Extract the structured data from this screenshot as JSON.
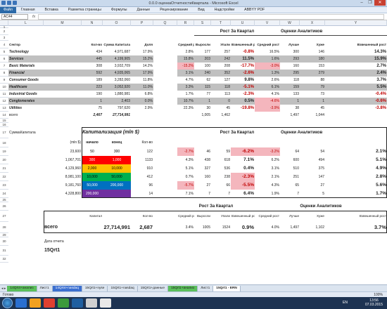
{
  "window": {
    "title": "0.0.0 оценкаОтчетностиКвартала - Microsoft Excel",
    "buttons": [
      "–",
      "❐",
      "✕"
    ]
  },
  "menu": {
    "file": "Файл",
    "items": [
      "Главная",
      "Вставка",
      "Разметка страницы",
      "Формулы",
      "Данные",
      "Рецензирование",
      "Вид",
      "Надстройки",
      "ABBYY PDF"
    ]
  },
  "formula_bar": {
    "name_box": "AC44",
    "fx": "fx",
    "content": ""
  },
  "columns": [
    "L",
    "M",
    "N",
    "O",
    "P",
    "Q",
    "R",
    "S",
    "T",
    "U",
    "V",
    "W",
    "X",
    "Y"
  ],
  "rows": [
    "1",
    "2",
    "3",
    "4",
    "5",
    "6",
    "7",
    "8",
    "9",
    "10",
    "11",
    "12",
    "13",
    "14",
    "15",
    "16",
    "17",
    "18",
    "19",
    "20",
    "21",
    "22",
    "23",
    "24",
    "25",
    "26",
    "27",
    "28",
    "29",
    "30",
    "31",
    "32"
  ],
  "sector_table": {
    "group_growth": "Рост За Квартал",
    "group_analysts": "Оценки Аналитиков",
    "headers": [
      "Сектор",
      "Кол-во",
      "Сумма Капитала",
      "Доля",
      "Средний рост",
      "Выросли",
      "Упали",
      "Взвешенный рост",
      "Средний рост",
      "Лучше",
      "Хуже",
      "Взвешенный рост"
    ],
    "rows": [
      [
        "Technology",
        "434",
        "4,971,687",
        "17.9%",
        "2.8%",
        "177",
        "257",
        "-0.8%",
        "16.5%",
        "300",
        "146",
        "14.3%"
      ],
      [
        "Services",
        "445",
        "4,199,905",
        "15.2%",
        "15.8%",
        "203",
        "242",
        "11.5%",
        "1.6%",
        "293",
        "180",
        "15.9%"
      ],
      [
        "Basic Materials",
        "308",
        "3,932,709",
        "14.2%",
        "-15.2%",
        "100",
        "208",
        "-17.7%",
        "-3.0%",
        "160",
        "153",
        "2.7%"
      ],
      [
        "Financial",
        "592",
        "4,935,065",
        "17.9%",
        "3.1%",
        "240",
        "352",
        "-2.6%",
        "1.3%",
        "295",
        "279",
        "2.4%"
      ],
      [
        "Consumer Goods",
        "189",
        "3,282,060",
        "11.8%",
        "4.7%",
        "62",
        "127",
        "9.8%",
        "2.6%",
        "118",
        "88",
        "3.7%"
      ],
      [
        "Healthcare",
        "223",
        "3,052,920",
        "11.0%",
        "3.3%",
        "115",
        "118",
        "-5.1%",
        "6.1%",
        "159",
        "79",
        "5.5%"
      ],
      [
        "Industrial Goods",
        "190",
        "1,880,981",
        "6.8%",
        "1.7%",
        "77",
        "113",
        "-2.3%",
        "4.1%",
        "133",
        "73",
        "-0.4%"
      ],
      [
        "Conglomerates",
        "1",
        "2,403",
        "0.0%",
        "10.7%",
        "1",
        "0",
        "0.5%",
        "-4.6%",
        "1",
        "1",
        "-0.6%"
      ],
      [
        "Utilities",
        "75",
        "797,620",
        "2.9%",
        "22.3%",
        "30",
        "45",
        "-19.8%",
        "-3.9%",
        "38",
        "45",
        "-3.8%"
      ]
    ],
    "total": {
      "label": "всего",
      "count": "2,467",
      "cap": "27,714,991",
      "up": "1,005",
      "down": "1,462",
      "better": "1,497",
      "worse": "1,044"
    }
  },
  "cap_table": {
    "label_sum": "СуммаКапитала",
    "title": "Капитализация (mln $)",
    "unit": "(mln $)",
    "col_start": "начало",
    "col_end": "конец",
    "col_count": "Кол-во",
    "group_growth": "Рост За Квартал",
    "group_analysts": "Оценки Аналитиков",
    "rows": [
      {
        "sum": "23,600",
        "start": "50",
        "end": "300",
        "color": "#ffffff",
        "count": "122",
        "avg": "-2.7%",
        "up": "46",
        "down": "59",
        "w": "-6.2%",
        "aavg": "-3.2%",
        "better": "64",
        "worse": "54",
        "aw": "2.1%"
      },
      {
        "sum": "1,067,701",
        "start": "300",
        "end": "1,000",
        "color": "#ff0000",
        "count": "1133",
        "avg": "4.3%",
        "up": "438",
        "down": "618",
        "w": "7.1%",
        "aavg": "6.2%",
        "better": "600",
        "worse": "494",
        "aw": "5.1%"
      },
      {
        "sum": "4,129,960",
        "start": "2,000",
        "end": "10,000",
        "color": "#ffc000",
        "count": "910",
        "avg": "5.1%",
        "up": "327",
        "down": "536",
        "w": "0.4%",
        "aavg": "3.1%",
        "better": "510",
        "worse": "375",
        "aw": "4.9%"
      },
      {
        "sum": "8,981,100",
        "start": "10,000",
        "end": "50,000",
        "color": "#00b050",
        "count": "412",
        "avg": "0.7%",
        "up": "160",
        "down": "238",
        "w": "-2.3%",
        "aavg": "2.1%",
        "better": "251",
        "worse": "147",
        "aw": "2.8%"
      },
      {
        "sum": "9,181,760",
        "start": "50,000",
        "end": "200,000",
        "color": "#0070c0",
        "count": "96",
        "avg": "-5.7%",
        "up": "27",
        "down": "66",
        "w": "-5.5%",
        "aavg": "4.3%",
        "better": "65",
        "worse": "27",
        "aw": "5.6%"
      },
      {
        "sum": "4,328,800",
        "start": "200,000",
        "end": "",
        "color": "#7030a0",
        "count": "14",
        "avg": "7.1%",
        "up": "7",
        "down": "7",
        "w": "6.4%",
        "aavg": "1.9%",
        "better": "7",
        "worse": "5",
        "aw": "1.7%"
      }
    ]
  },
  "summary": {
    "group_growth": "Рост За Квартал",
    "group_analysts": "Оценки Аналитиков",
    "headers": [
      "Капитал",
      "Кол-во",
      "Средний рост",
      "Выросли",
      "Упали",
      "Взвешенный рост",
      "Средний рост",
      "Лучше",
      "Хуже",
      "Взвешенный рост"
    ],
    "label": "всего",
    "values": [
      "27,714,991",
      "2,687",
      "3.4%",
      "1005",
      "1524",
      "0.9%",
      "4.0%",
      "1,497",
      "1,102",
      "3.7%"
    ]
  },
  "report_date": {
    "label": "Дата отчета",
    "value": "15Qrt1"
  },
  "sheet_tabs": [
    {
      "label": "14Qrt4+анализ",
      "style": "green"
    },
    {
      "label": "Лист1",
      "style": ""
    },
    {
      "label": "14Qrt4+nasdaq",
      "style": "blue"
    },
    {
      "label": "15Qrt1+nyse",
      "style": ""
    },
    {
      "label": "15Qrt1+nasdaq",
      "style": ""
    },
    {
      "label": "15Qrt1+данные",
      "style": ""
    },
    {
      "label": "15Qrt1+анализ",
      "style": "green"
    },
    {
      "label": "Лист1",
      "style": ""
    },
    {
      "label": "15Qrt1 - ERN",
      "style": "active"
    }
  ],
  "status": {
    "ready": "Готово",
    "zoom": "100%"
  },
  "taskbar": {
    "lang": "EN",
    "time": "13:56",
    "date": "07.03.2015",
    "apps": [
      "#2a6fd0",
      "#f0a020",
      "#e04030",
      "#3c9a3c",
      "#1f5fa0",
      "#d0d0d0",
      "#e8e8e8"
    ]
  }
}
